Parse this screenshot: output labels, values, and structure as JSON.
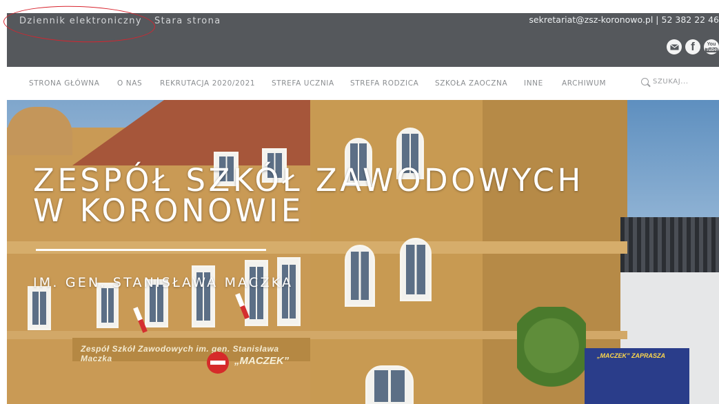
{
  "topbar": {
    "links": [
      {
        "label": "Dziennik elektroniczny"
      },
      {
        "label": "Stara strona"
      }
    ],
    "contact": "sekretariat@zsz-koronowo.pl | 52 382 22 46",
    "socials": [
      {
        "name": "mail-icon"
      },
      {
        "name": "facebook-icon",
        "glyph": "f"
      },
      {
        "name": "youtube-icon",
        "glyph_top": "You",
        "glyph_bottom": "Tube"
      }
    ]
  },
  "nav": {
    "items": [
      "STRONA GŁÓWNA",
      "O NAS",
      "REKRUTACJA 2020/2021",
      "STREFA UCZNIA",
      "STREFA RODZICA",
      "SZKOŁA ZAOCZNA",
      "INNE",
      "ARCHIWUM"
    ],
    "search_label": "SZUKAJ..."
  },
  "hero": {
    "title_line1": "ZESPÓŁ SZKÓŁ ZAWODOWYCH",
    "title_line2": "W KORONOWIE",
    "subtitle": "IM. GEN. STANISŁAWA MACZKA",
    "sign_text": "Zespół Szkół Zawodowych im. gen. Stanisława Maczka",
    "sign_name": "„MACZEK”",
    "banner_text": "„MACZEK” ZAPRASZA"
  },
  "colors": {
    "topbar": "#55585c",
    "annotation": "#d8242e",
    "nav_text": "#8a8d90"
  }
}
